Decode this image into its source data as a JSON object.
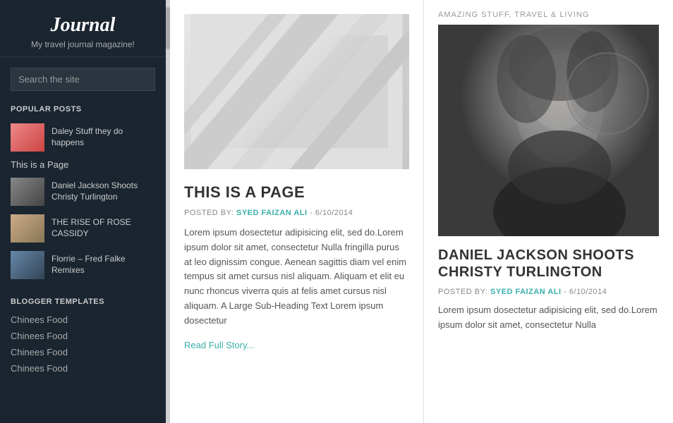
{
  "sidebar": {
    "title": "Journal",
    "subtitle": "My travel journal magazine!",
    "search_placeholder": "Search the site",
    "popular_posts_label": "POPULAR POSTS",
    "popular_posts": [
      {
        "title": "Daley Stuff they do happens",
        "thumb_class": "thumb-1"
      },
      {
        "title": "Daniel Jackson Shoots Christy Turlington",
        "thumb_class": "thumb-2"
      },
      {
        "title": "THE RISE OF ROSE CASSIDY",
        "thumb_class": "thumb-3"
      },
      {
        "title": "Florrie – Fred Falke Remixes",
        "thumb_class": "thumb-4"
      }
    ],
    "page_link": "This is a Page",
    "blogger_templates_label": "BLOGGER TEMPLATES",
    "blogger_links": [
      "Chinees Food",
      "Chinees Food",
      "Chinees Food",
      "Chinees Food"
    ]
  },
  "center_article": {
    "title": "THIS IS A PAGE",
    "meta_prefix": "POSTED BY:",
    "author": "SYED FAIZAN ALI",
    "date": "6/10/2014",
    "body": "Lorem ipsum dosectetur adipisicing elit, sed do.Lorem ipsum dolor sit amet, consectetur Nulla fringilla purus at leo dignissim congue. Aenean sagittis diam vel enim tempus sit amet cursus nisl aliquam. Aliquam et elit eu nunc rhoncus viverra quis at felis amet cursus nisl aliquam. A Large Sub-Heading Text Lorem ipsum dosectetur",
    "read_more": "Read Full Story..."
  },
  "right_article": {
    "category": "AMAZING STUFF, TRAVEL & LIVING",
    "title": "DANIEL JACKSON SHOOTS CHRISTY TURLINGTON",
    "meta_prefix": "POSTED BY:",
    "author": "SYED FAIZAN ALI",
    "date": "6/10/2014",
    "body": "Lorem ipsum dosectetur adipisicing elit, sed do.Lorem ipsum dolor sit amet, consectetur Nulla"
  },
  "colors": {
    "accent": "#3aafa9",
    "sidebar_bg": "#1a2530",
    "text_dark": "#333",
    "text_muted": "#888"
  }
}
